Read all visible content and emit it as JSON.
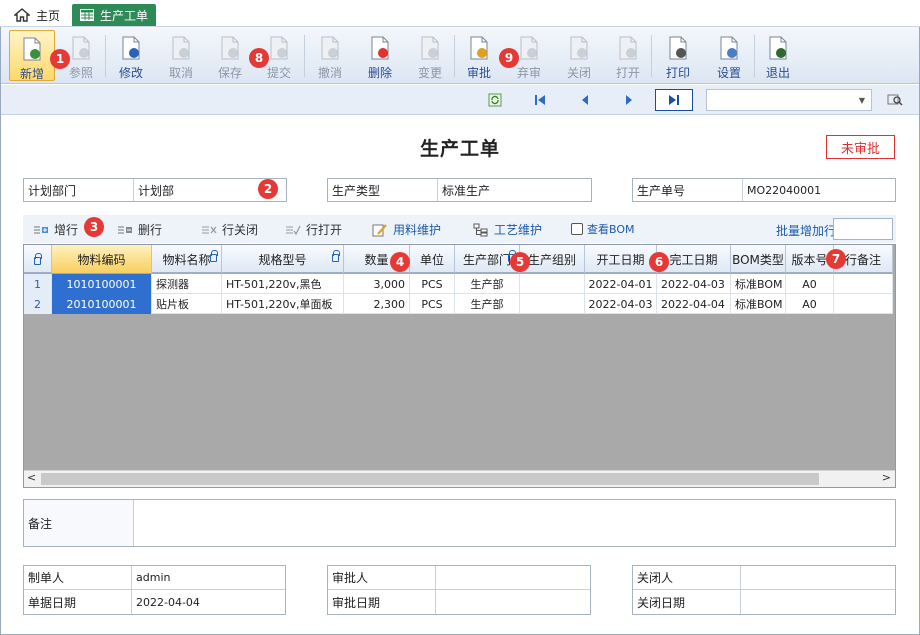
{
  "tabs": [
    {
      "label": "主页"
    },
    {
      "label": "生产工单"
    }
  ],
  "toolbar": [
    {
      "label": "新增",
      "icon": "new-doc-icon",
      "enabled": true,
      "active": true
    },
    {
      "label": "参照",
      "icon": "reference-icon",
      "enabled": false
    },
    {
      "label": "修改",
      "icon": "edit-icon",
      "enabled": true
    },
    {
      "label": "取消",
      "icon": "undo-icon",
      "enabled": false
    },
    {
      "label": "保存",
      "icon": "save-icon",
      "enabled": false
    },
    {
      "label": "提交",
      "icon": "submit-icon",
      "enabled": false
    },
    {
      "label": "撤消",
      "icon": "revoke-icon",
      "enabled": false
    },
    {
      "label": "删除",
      "icon": "delete-icon",
      "enabled": true
    },
    {
      "label": "变更",
      "icon": "change-icon",
      "enabled": false
    },
    {
      "label": "审批",
      "icon": "approve-icon",
      "enabled": true
    },
    {
      "label": "弃审",
      "icon": "unapprove-icon",
      "enabled": false
    },
    {
      "label": "关闭",
      "icon": "close-doc-icon",
      "enabled": false
    },
    {
      "label": "打开",
      "icon": "open-doc-icon",
      "enabled": false
    },
    {
      "label": "打印",
      "icon": "print-icon",
      "enabled": true
    },
    {
      "label": "设置",
      "icon": "settings-icon",
      "enabled": true
    },
    {
      "label": "退出",
      "icon": "exit-icon",
      "enabled": true
    }
  ],
  "badges": [
    "1",
    "2",
    "3",
    "4",
    "5",
    "6",
    "7",
    "8",
    "9"
  ],
  "form": {
    "title": "生产工单",
    "status": "未审批",
    "fields": {
      "plan_dept_label": "计划部门",
      "plan_dept_value": "计划部",
      "prod_type_label": "生产类型",
      "prod_type_value": "标准生产",
      "order_no_label": "生产单号",
      "order_no_value": "MO22040001"
    }
  },
  "grid_toolbar": {
    "add_row": "增行",
    "delete_row": "删行",
    "close_row": "行关闭",
    "open_row": "行打开",
    "material_maint": "用料维护",
    "process_maint": "工艺维护",
    "view_bom": "查看BOM",
    "batch_add_label": "批量增加行数"
  },
  "grid": {
    "columns": [
      "物料编码",
      "物料名称",
      "规格型号",
      "数量",
      "单位",
      "生产部门",
      "生产组别",
      "开工日期",
      "完工日期",
      "BOM类型",
      "版本号",
      "行备注"
    ],
    "rows": [
      {
        "no": "1",
        "code": "1010100001",
        "name": "探测器",
        "spec": "HT-501,220v,黑色",
        "qty": "3,000",
        "unit": "PCS",
        "dept": "生产部",
        "group": "",
        "start": "2022-04-01",
        "end": "2022-04-03",
        "bom": "标准BOM",
        "ver": "A0",
        "note": ""
      },
      {
        "no": "2",
        "code": "2010100001",
        "name": "贴片板",
        "spec": "HT-501,220v,单面板",
        "qty": "2,300",
        "unit": "PCS",
        "dept": "生产部",
        "group": "",
        "start": "2022-04-03",
        "end": "2022-04-04",
        "bom": "标准BOM",
        "ver": "A0",
        "note": ""
      }
    ]
  },
  "remark": {
    "label": "备注"
  },
  "footer": {
    "creator_label": "制单人",
    "creator_value": "admin",
    "date_label": "单据日期",
    "date_value": "2022-04-04",
    "approver_label": "审批人",
    "approver_value": "",
    "approve_date_label": "审批日期",
    "approve_date_value": "",
    "closer_label": "关闭人",
    "closer_value": "",
    "close_date_label": "关闭日期",
    "close_date_value": ""
  },
  "colors": {
    "accent": "#2e8b57",
    "badge": "#e53935",
    "status": "#e03030",
    "selected": "#2f6fd0"
  }
}
